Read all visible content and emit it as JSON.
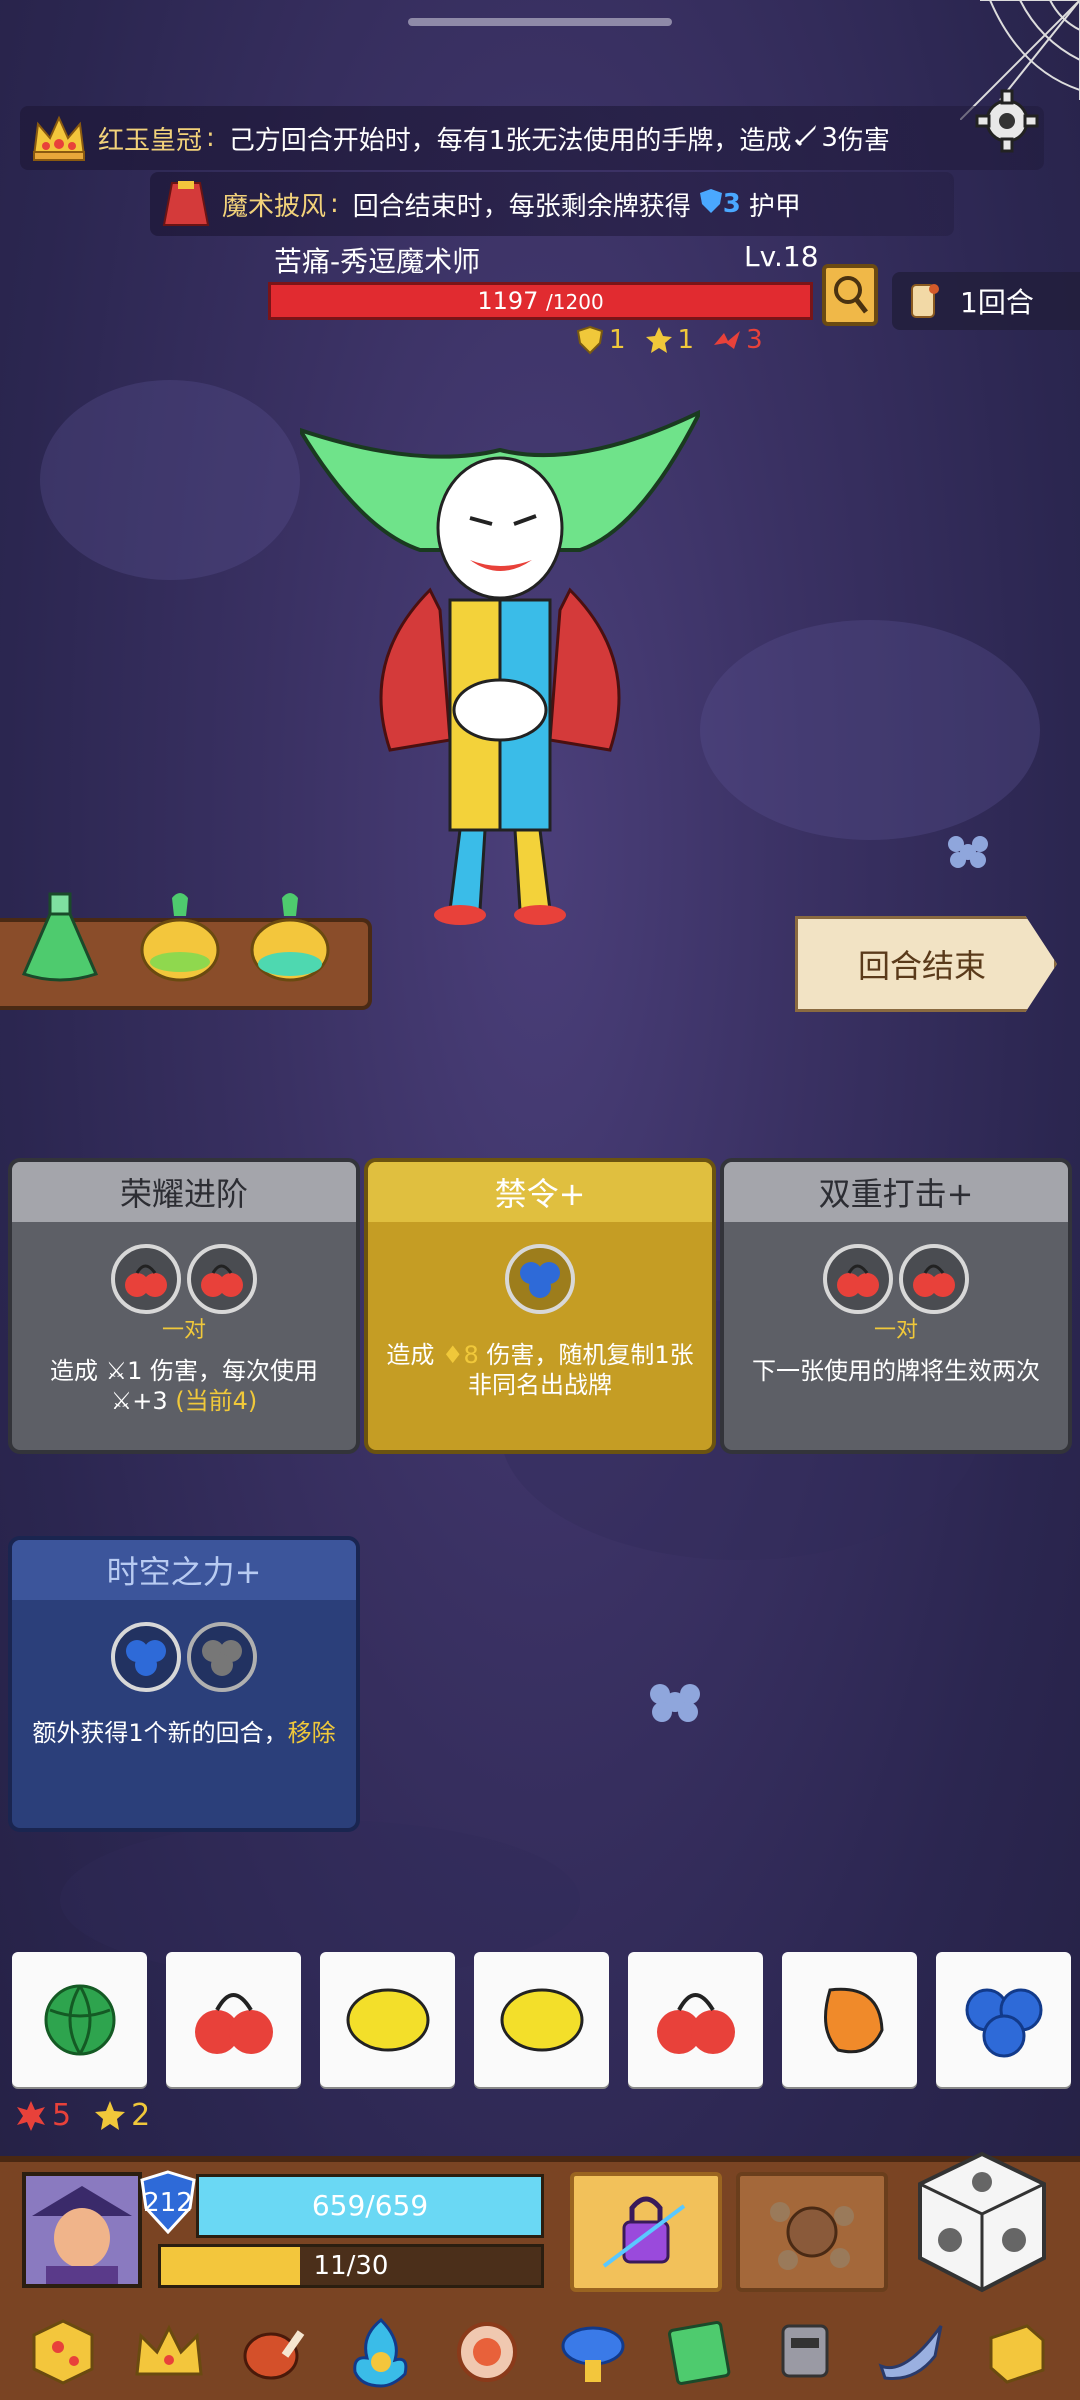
{
  "relics": [
    {
      "name": "红玉皇冠",
      "colon": ":",
      "desc": "己方回合开始时，每有1张无法使用的手牌，造成",
      "value": "3",
      "unit": "伤害"
    },
    {
      "name": "魔术披风",
      "colon": ":",
      "desc": "回合结束时，每张剩余牌获得",
      "value": "3",
      "unit": "护甲"
    }
  ],
  "enemy": {
    "name": "苦痛-秀逗魔术师",
    "level": "Lv.18",
    "hp_current": "1197",
    "hp_max": "/1200",
    "hp_fraction": 0.9975,
    "status": [
      {
        "icon": "shield-status-icon",
        "value": "1",
        "color": "#f0c83a"
      },
      {
        "icon": "star-status-icon",
        "value": "1",
        "color": "#f0c83a"
      },
      {
        "icon": "weakness-status-icon",
        "value": "3",
        "color": "#e8413a"
      }
    ]
  },
  "round": {
    "label": "1回合"
  },
  "end_turn": {
    "label": "回合结束"
  },
  "cards": [
    {
      "title": "荣耀进阶",
      "slots": [
        "cherry-icon",
        "cherry-icon"
      ],
      "pair_label": "一对",
      "desc_a": "造成 ",
      "desc_b": "1 伤害，每次使用 ",
      "desc_c": "+3 ",
      "desc_d": "(当前4)"
    },
    {
      "title": "禁令+",
      "slots": [
        "blueberry-icon"
      ],
      "desc_a": "造成 ",
      "desc_b": "8 ",
      "desc_c": "伤害，随机复制1张非同名出战牌"
    },
    {
      "title": "双重打击+",
      "slots": [
        "cherry-icon",
        "cherry-icon"
      ],
      "pair_label": "一对",
      "desc": "下一张使用的牌将生效两次"
    },
    {
      "title": "时空之力+",
      "slots": [
        "blueberry-icon",
        "blueberry-icon"
      ],
      "desc_a": "额外获得1个新的回合，",
      "desc_b": "移除"
    }
  ],
  "hand": [
    "watermelon-icon",
    "cherry-icon",
    "lemon-icon",
    "lemon-icon",
    "cherry-icon",
    "mango-icon",
    "blueberry-icon"
  ],
  "counters": [
    {
      "icon": "burst-icon",
      "value": "5",
      "color": "#e8413a"
    },
    {
      "icon": "star-icon",
      "value": "2",
      "color": "#f0c83a"
    }
  ],
  "player": {
    "armor": "212",
    "hp": "659/659",
    "hp_fraction": 1.0,
    "xp": "11/30",
    "xp_fraction": 0.3667
  },
  "colors": {
    "hp_red": "#e12b30",
    "card_grey": "#5d5f66",
    "card_gold": "#c59d24",
    "card_blue": "#2b3f7a",
    "accent_yellow": "#f0c83a"
  }
}
